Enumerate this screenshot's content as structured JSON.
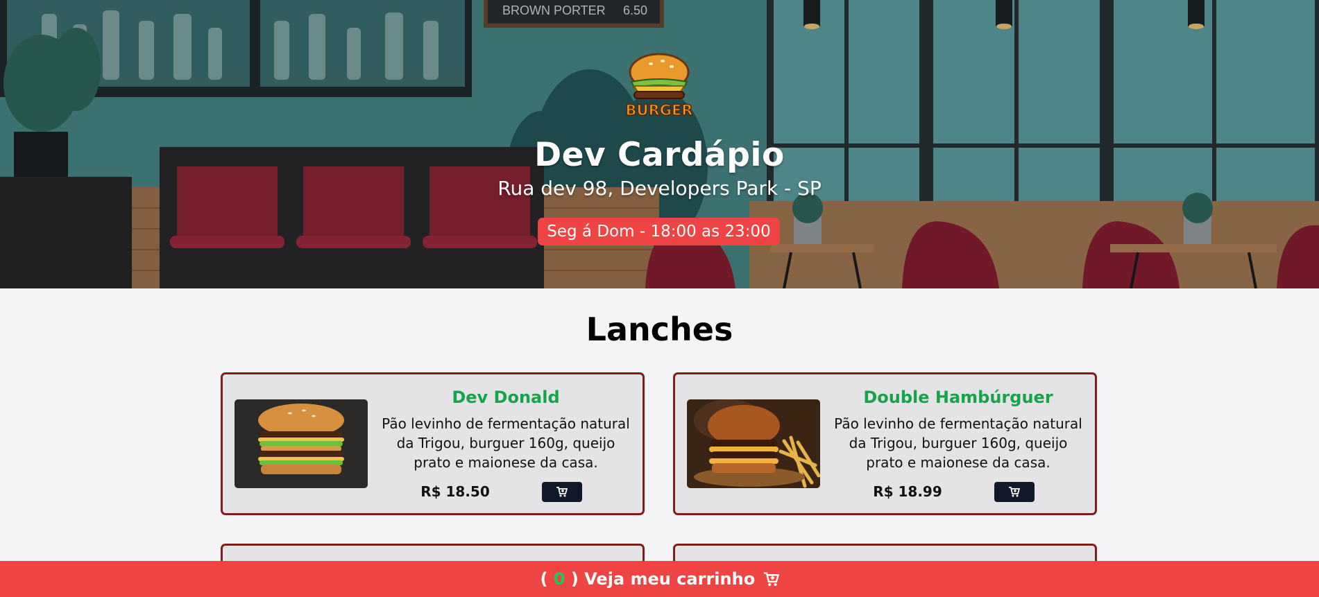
{
  "header": {
    "logo_text": "BURGER",
    "title": "Dev Cardápio",
    "address": "Rua dev 98, Developers Park - SP",
    "hours": "Seg á Dom - 18:00 as 23:00",
    "chalkboard_item": "BROWN PORTER",
    "chalkboard_price": "6.50"
  },
  "menu": {
    "section_title": "Lanches",
    "items": [
      {
        "name": "Dev Donald",
        "description": "Pão levinho de fermentação natural da Trigou, burguer 160g, queijo prato e maionese da casa.",
        "price": "R$ 18.50",
        "image_icon": "big-mac-burger-photo"
      },
      {
        "name": "Double Hambúrguer",
        "description": "Pão levinho de fermentação natural da Trigou, burguer 160g, queijo prato e maionese da casa.",
        "price": "R$ 18.99",
        "image_icon": "double-burger-fries-photo"
      }
    ]
  },
  "cart": {
    "open_paren": "(",
    "count": "0",
    "label": ") Veja meu carrinho",
    "icon": "cart-plus-icon"
  },
  "colors": {
    "accent_red": "#ef4444",
    "name_green": "#16a34a",
    "card_border": "#7f1d1d",
    "button_dark": "#111827"
  }
}
